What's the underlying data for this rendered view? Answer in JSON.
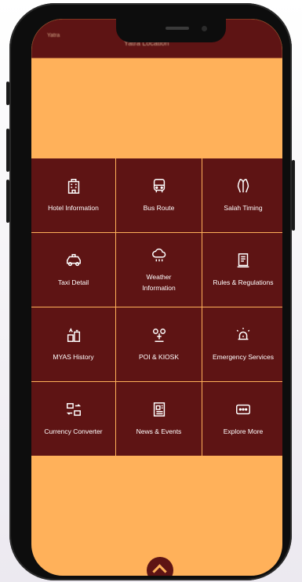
{
  "app": {
    "logo_text": "Yatra",
    "header_title": "Yatra Location"
  },
  "colors": {
    "primary": "#5e1414",
    "background": "#ffb15a",
    "text": "#ffffff"
  },
  "menu": [
    {
      "label": "Hotel Information",
      "icon": "hotel-icon"
    },
    {
      "label": "Bus Route",
      "icon": "bus-icon"
    },
    {
      "label": "Salah Timing",
      "icon": "prayer-hands-icon"
    },
    {
      "label": "Taxi Detail",
      "icon": "taxi-icon"
    },
    {
      "label": "Weather Information",
      "icon": "weather-icon"
    },
    {
      "label": "Rules & Regulations",
      "icon": "rules-icon"
    },
    {
      "label": "MYAS History",
      "icon": "history-icon"
    },
    {
      "label": "POI & KIOSK",
      "icon": "kiosk-icon"
    },
    {
      "label": "Emergency Services",
      "icon": "emergency-icon"
    },
    {
      "label": "Currency Converter",
      "icon": "currency-icon"
    },
    {
      "label": "News & Events",
      "icon": "news-icon"
    },
    {
      "label": "Explore More",
      "icon": "explore-icon"
    }
  ],
  "fab": {
    "icon": "chevron-up-icon"
  }
}
